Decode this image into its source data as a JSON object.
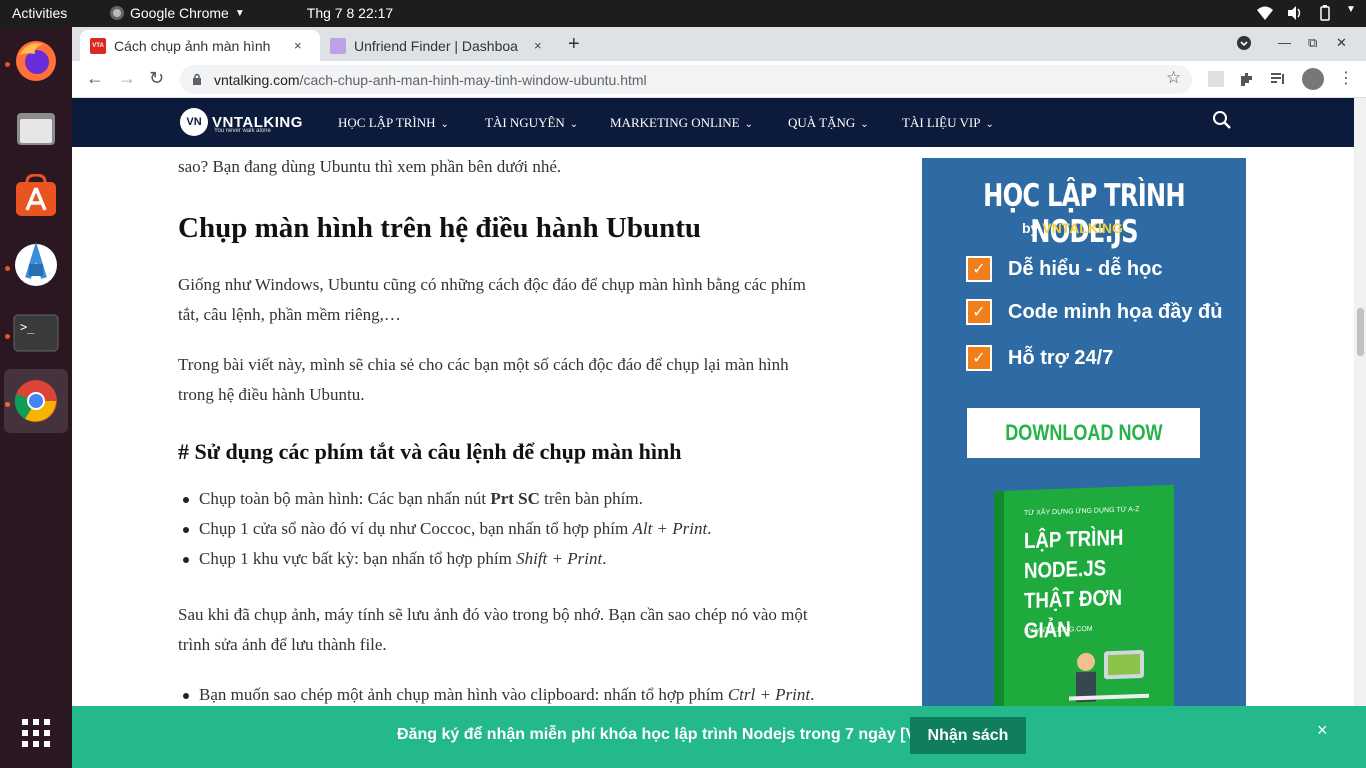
{
  "topbar": {
    "activities": "Activities",
    "app_name": "Google Chrome",
    "clock": "Thg 7 8  22:17"
  },
  "dock": {
    "items": [
      "firefox-icon",
      "files-icon",
      "software-icon",
      "android-studio-icon",
      "terminal-icon",
      "chrome-icon",
      "show-apps-icon"
    ]
  },
  "tabs": [
    {
      "title": "Cách chụp ảnh màn hình",
      "close": "×"
    },
    {
      "title": "Unfriend Finder | Dashboa",
      "close": "×"
    }
  ],
  "toolbar": {
    "new_tab": "+",
    "back": "←",
    "forward": "→",
    "reload": "↻",
    "url_domain": "vntalking.com",
    "url_path": "/cach-chup-anh-man-hinh-may-tinh-window-ubuntu.html",
    "star": "☆"
  },
  "site": {
    "logo_mark": "VN",
    "logo_text": "VNTALKING",
    "logo_tagline": "You never walk alone",
    "menu": [
      "HỌC LẬP TRÌNH",
      "TÀI NGUYÊN",
      "MARKETING ONLINE",
      "QUÀ TẶNG",
      "TÀI LIỆU VIP"
    ]
  },
  "article": {
    "p0": "sao? Bạn đang dùng Ubuntu thì xem phần bên dưới nhé.",
    "h2": "Chụp màn hình trên hệ điều hành Ubuntu",
    "p1a": "Giống như Windows, Ubuntu cũng có những cách độc đáo để chụp màn hình bằng các phím",
    "p1b": "tắt, câu lệnh, phần mềm riêng,…",
    "p2a": "Trong bài viết này, mình sẽ chia sẻ cho các bạn một số cách độc đáo để chụp lại màn hình",
    "p2b": "trong hệ điều hành Ubuntu.",
    "h3": "# Sử dụng các phím tắt và câu lệnh để chụp màn hình",
    "li1_pre": "Chụp toàn bộ màn hình: Các bạn nhấn nút ",
    "li1_key": "Prt SC",
    "li1_post": " trên bàn phím.",
    "li2_pre": "Chụp 1 cửa sổ nào đó ví dụ như Coccoc, bạn nhấn tổ hợp phím ",
    "li2_key": "Alt + Print",
    "li2_post": ".",
    "li3_pre": "Chụp 1 khu vực bất kỳ: bạn nhấn tổ hợp phím ",
    "li3_key": "Shift + Print",
    "li3_post": ".",
    "p3a": "Sau khi đã chụp ảnh, máy tính sẽ lưu ảnh đó vào trong bộ nhớ. Bạn cần sao chép nó vào một",
    "p3b": "trình sửa ảnh để lưu thành file.",
    "li4_pre": "Bạn muốn sao chép một ảnh chụp màn hình vào clipboard: nhấn tổ hợp phím ",
    "li4_key": "Ctrl + Print",
    "li4_post": "."
  },
  "ad": {
    "heading": "HỌC LẬP TRÌNH NODE.JS",
    "by": "by ",
    "brand": "VNTALKING",
    "features": [
      "Dễ hiểu - dễ học",
      "Code minh họa đầy đủ",
      "Hỗ trợ 24/7"
    ],
    "check": "✓",
    "download": "DOWNLOAD NOW",
    "book_small": "TỪ XÂY DỰNG ỨNG DỤNG TỪ A-Z",
    "book_title": "LẬP TRÌNH NODE.JS THẬT ĐƠN GIẢN",
    "book_by": "BY VNTALKING.COM"
  },
  "bottombar": {
    "message": "Đăng ký để nhận miễn phí khóa học lập trình Nodejs trong 7 ngày [Video].",
    "button": "Nhận sách",
    "close": "×"
  }
}
